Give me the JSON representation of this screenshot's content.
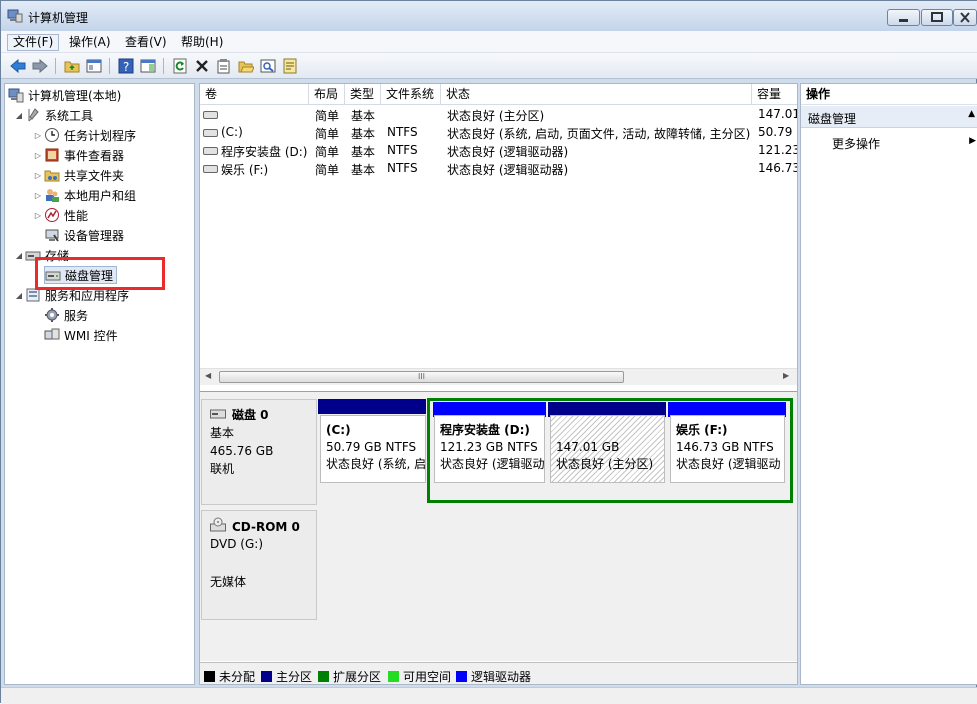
{
  "window": {
    "title": "计算机管理"
  },
  "menu": [
    "文件(F)",
    "操作(A)",
    "查看(V)",
    "帮助(H)"
  ],
  "toolbar": {
    "icons": [
      "back-icon",
      "forward-icon",
      "up-folder-icon",
      "show-tree-icon",
      "help-icon",
      "show-action-pane-icon",
      "refresh-icon",
      "delete-icon",
      "properties-icon",
      "open-icon",
      "search-icon",
      "export-icon"
    ]
  },
  "tree": {
    "root": "计算机管理(本地)",
    "system_tools": "系统工具",
    "task_scheduler": "任务计划程序",
    "event_viewer": "事件查看器",
    "shared_folders": "共享文件夹",
    "local_users": "本地用户和组",
    "performance": "性能",
    "device_manager": "设备管理器",
    "storage": "存储",
    "disk_management": "磁盘管理",
    "services_apps": "服务和应用程序",
    "services": "服务",
    "wmi": "WMI 控件"
  },
  "volume_list": {
    "headers": [
      "卷",
      "布局",
      "类型",
      "文件系统",
      "状态",
      "容量"
    ],
    "rows": [
      {
        "vol": "",
        "layout": "简单",
        "type": "基本",
        "fs": "",
        "status": "状态良好 (主分区)",
        "capacity": "147.01"
      },
      {
        "vol": "(C:)",
        "layout": "简单",
        "type": "基本",
        "fs": "NTFS",
        "status": "状态良好 (系统, 启动, 页面文件, 活动, 故障转储, 主分区)",
        "capacity": "50.79 ("
      },
      {
        "vol": "程序安装盘 (D:)",
        "layout": "简单",
        "type": "基本",
        "fs": "NTFS",
        "status": "状态良好 (逻辑驱动器)",
        "capacity": "121.23"
      },
      {
        "vol": "娱乐 (F:)",
        "layout": "简单",
        "type": "基本",
        "fs": "NTFS",
        "status": "状态良好 (逻辑驱动器)",
        "capacity": "146.73"
      }
    ]
  },
  "hscroll": {
    "grip": "III"
  },
  "disks": {
    "disk0": {
      "name": "磁盘 0",
      "type": "基本",
      "size": "465.76 GB",
      "state": "联机"
    },
    "cdrom0": {
      "name": "CD-ROM 0",
      "drive": "DVD (G:)",
      "state": "无媒体"
    }
  },
  "partitions": [
    {
      "name": "(C:)",
      "size": "50.79 GB NTFS",
      "status": "状态良好 (系统, 启"
    },
    {
      "name": "程序安装盘  (D:)",
      "size": "121.23 GB NTFS",
      "status": "状态良好 (逻辑驱动"
    },
    {
      "name": "",
      "size": "147.01 GB",
      "status": "状态良好 (主分区)"
    },
    {
      "name": "娱乐  (F:)",
      "size": "146.73 GB NTFS",
      "status": "状态良好 (逻辑驱动"
    }
  ],
  "legend": [
    {
      "label": "未分配",
      "color": "#000000"
    },
    {
      "label": "主分区",
      "color": "#00008b"
    },
    {
      "label": "扩展分区",
      "color": "#008000"
    },
    {
      "label": "可用空间",
      "color": "#22dd22"
    },
    {
      "label": "逻辑驱动器",
      "color": "#0000ff"
    }
  ],
  "actions": {
    "header": "操作",
    "section": "磁盘管理",
    "more": "更多操作"
  },
  "colors": {
    "primary_bar": "#00008b",
    "logical_bar": "#0000ff",
    "extended_border": "#008000",
    "highlight": "#ea2b2b"
  }
}
